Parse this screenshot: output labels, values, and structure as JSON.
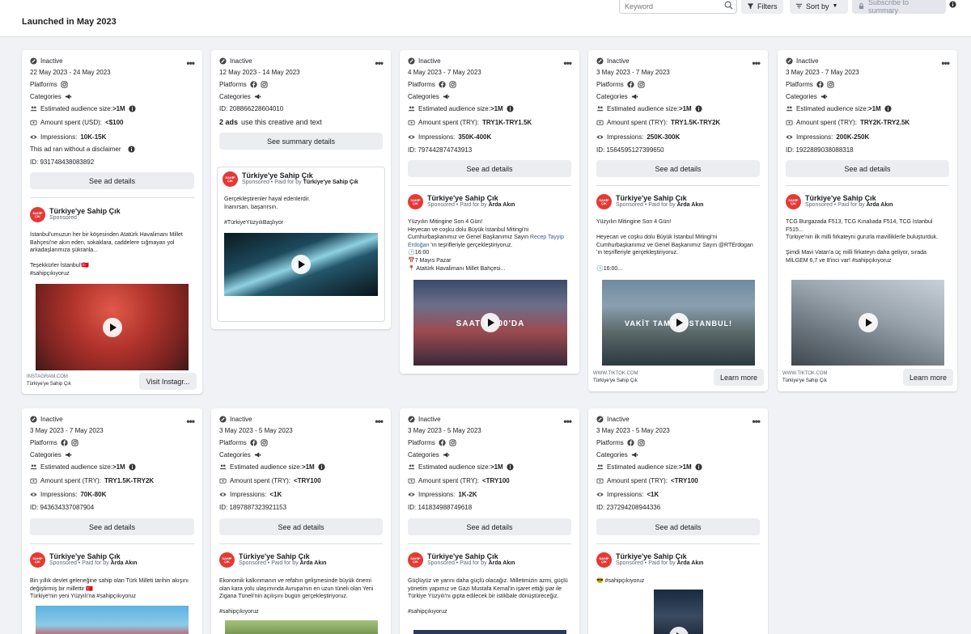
{
  "header": {
    "title": "Launched in May 2023",
    "search_placeholder": "Keyword",
    "filters_label": "Filters",
    "sort_label": "Sort by",
    "subscribe_label": "Subscribe to summary"
  },
  "colors": {
    "accent": "#385898",
    "brand_red": "#e53935",
    "button_gray": "#ebedf0"
  },
  "labels": {
    "platforms": "Platforms",
    "categories": "Categories",
    "audience": "Estimated audience size:",
    "impressions": "Impressions:",
    "see_ad_details": "See ad details",
    "see_summary": "See summary details",
    "sponsored": "Sponsored",
    "paid_by": "Paid for by",
    "page_name": "Türkiye'ye Sahip Çık",
    "logo_text": "SAHİP ÇIK"
  },
  "cards": [
    {
      "status": "Inactive",
      "dates": "22 May 2023 - 24 May 2023",
      "audience": ">1M",
      "spent_label": "Amount spent (USD):",
      "spent": "<$100",
      "impressions": "10K-15K",
      "disclaimer": "This ad ran without a disclaimer",
      "id": "ID: 931748438083892",
      "payer": "",
      "text": "İstanbul'umuzun her bir köşesinden Atatürk Havalimanı Millet Bahçesi'ne akın eden, sokaklara, caddelere sığmayan yol arkadaşlarımıza şükranla...\n\nTeşekkürler İstanbul!🇹🇷\n#sahipçıkıyoruz",
      "footer_domain": "INSTAGRAM.COM",
      "footer_name": "Türkiye'ye Sahip Çık",
      "cta": "Visit Instagr..."
    },
    {
      "status": "Inactive",
      "dates": "12 May 2023 - 14 May 2023",
      "id": "ID: 208866228604010",
      "ads_count": "2 ads",
      "ads_text": "use this creative and text",
      "payer": "Türkiye'ye Sahip Çık",
      "text": "Gerçekleştirenler hayal edenlerdir.\nİnanırsan, başarırsın.\n\n#TürkiyeYüzyılıBaşlıyor"
    },
    {
      "status": "Inactive",
      "dates": "4 May 2023 - 7 May 2023",
      "audience": ">1M",
      "spent_label": "Amount spent (TRY):",
      "spent": "TRY1K-TRY1.5K",
      "impressions": "350K-400K",
      "id": "ID: 797442874743913",
      "payer": "Arda Akın",
      "text": "Yüzyılın Mitingine Son 4 Gün!\nHeyecan ve coşku dolu Büyük İstanbul Mitingi'ni Cumhurbaşkanımız ve Genel Başkanımız Sayın",
      "link": "Recep Tayyip Erdoğan",
      "text2": " 'ın teşrifleriyle gerçekleştiriyoruz.\n🕒16:00\n📅7 Mayıs Pazar\n📍 Atatürk Havalimanı Millet Bahçesi...",
      "overlay": "SAAT 16:00'DA"
    },
    {
      "status": "Inactive",
      "dates": "3 May 2023 - 7 May 2023",
      "audience": ">1M",
      "spent_label": "Amount spent (TRY):",
      "spent": "TRY1.5K-TRY2K",
      "impressions": "250K-300K",
      "id": "ID: 1564595127399650",
      "payer": "Arda Akın",
      "text": "Yüzyılın Mitingine Son 4 Gün!\n\nHeyecan ve coşku dolu Büyük İstanbul Mitingi'ni Cumhurbaşkanımız ve Genel Başkanımız Sayın @RTErdogan 'ın teşrifleriyle gerçekleştiriyoruz.\n\n🕒16:00...",
      "overlay": "VAKİT TAMAM İSTANBUL!",
      "footer_domain": "WWW.TIKTOK.COM",
      "footer_name": "Türkiye'ye Sahip Çık",
      "cta": "Learn more"
    },
    {
      "status": "Inactive",
      "dates": "3 May 2023 - 7 May 2023",
      "audience": ">1M",
      "spent_label": "Amount spent (TRY):",
      "spent": "TRY2K-TRY2.5K",
      "impressions": "200K-250K",
      "id": "ID: 1922889038088318",
      "payer": "Arda Akın",
      "text": "TCG Burgazada F513, TCG Kınalıada F514, TCG İstanbul F515...\nTürkiye'nin ilk milli firkateyni gururla mavilliklerle buluşturduk.\n\nŞimdi Mavi Vatan'a üç milli firkateyn daha geliyor, sırada MİLGEM 6,7 ve 8'inci var! #sahipçıkıyoruz",
      "footer_domain": "WWW.TIKTOK.COM",
      "footer_name": "Türkiye'ye Sahip Çık",
      "cta": "Learn more"
    },
    {
      "status": "Inactive",
      "dates": "3 May 2023 - 7 May 2023",
      "audience": ">1M",
      "spent_label": "Amount spent (TRY):",
      "spent": "TRY1.5K-TRY2K",
      "impressions": "70K-80K",
      "id": "ID: 943634337087904",
      "payer": "Arda Akın",
      "text": "Bin yıllık devlet geleneğine sahip olan Türk Milleti tarihin akışını değiştirmiş bir millettir 🇹🇷\nTürkiye'nin yeni Yüzyılı'na #sahipçıkıyoruz"
    },
    {
      "status": "Inactive",
      "dates": "3 May 2023 - 5 May 2023",
      "audience": ">1M",
      "spent_label": "Amount spent (TRY):",
      "spent": "<TRY100",
      "impressions": "<1K",
      "id": "ID: 1897887323921153",
      "payer": "Arda Akın",
      "text": "Ekonomik kalkınmanın ve refahın gelişmesinde büyük önemi olan kara yolu ulaşımında Avrupa'nın en uzun tüneli olan Yeni Zigana Tüneli'nin açılışını bugün gerçekleştiriyoruz.\n\n#sahipçıkıyoruz"
    },
    {
      "status": "Inactive",
      "dates": "3 May 2023 - 5 May 2023",
      "audience": ">1M",
      "spent_label": "Amount spent (TRY):",
      "spent": "<TRY100",
      "impressions": "1K-2K",
      "id": "ID: 141834988749618",
      "payer": "Arda Akın",
      "text": "Güçlüyüz ve yarını daha güçlü olacağız. Milletimizin azmi, güçlü yönetim yapımız ve Gazi Mustafa Kemal'in işaret ettiği şiar ile Türkiye Yüzyılı'nı gıpta edilecek bir istikbale dönüştüreceğiz.\n\n#sahipçıkıyoruz"
    },
    {
      "status": "Inactive",
      "dates": "3 May 2023 - 5 May 2023",
      "audience": ">1M",
      "spent_label": "Amount spent (TRY):",
      "spent": "<TRY100",
      "impressions": "<1K",
      "id": "ID: 237294208944336",
      "payer": "Arda Akın",
      "text": "😎 #sahipçıkıyoruz"
    }
  ]
}
